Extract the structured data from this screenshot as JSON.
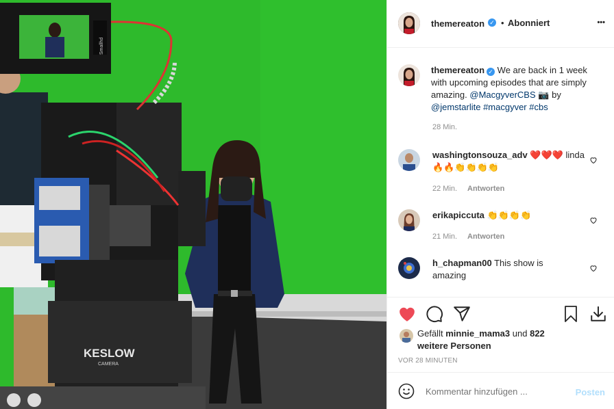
{
  "post": {
    "username": "themereaton",
    "follow_status": "Abonniert",
    "more": "•••",
    "caption": {
      "text_1": "We are back in 1 week with upcoming episodes that are simply amazing.",
      "mention_1": "@MacgyverCBS",
      "camera_emoji": "📷",
      "by": "by",
      "mention_2": "@jemstarlite",
      "tag_1": "#macgyver",
      "tag_2": "#cbs",
      "time": "28 Min."
    },
    "photo": {
      "monitor_brand": "Smallhd",
      "camera_brand": "KESLOW",
      "camera_sub": "CAMERA"
    }
  },
  "comments": [
    {
      "username": "washingtonsouza_adv",
      "text": "❤️❤️❤️ linda🔥🔥👏👏👏👏",
      "time": "22 Min.",
      "reply": "Antworten"
    },
    {
      "username": "erikapiccuta",
      "text": "👏👏👏👏",
      "time": "21 Min.",
      "reply": "Antworten"
    },
    {
      "username": "h_chapman00",
      "text": "This show is amazing"
    }
  ],
  "likes": {
    "prefix": "Gefällt",
    "user": "minnie_mama3",
    "and": "und",
    "others": "822 weitere Personen"
  },
  "timestamp": "VOR 28 MINUTEN",
  "comment_input": {
    "placeholder": "Kommentar hinzufügen ...",
    "post_label": "Posten"
  },
  "colors": {
    "like_red": "#ed4956",
    "link_blue": "#00376b",
    "post_disabled": "#b2dffc",
    "verified_blue": "#3897f0",
    "green_screen": "#2db92b"
  }
}
